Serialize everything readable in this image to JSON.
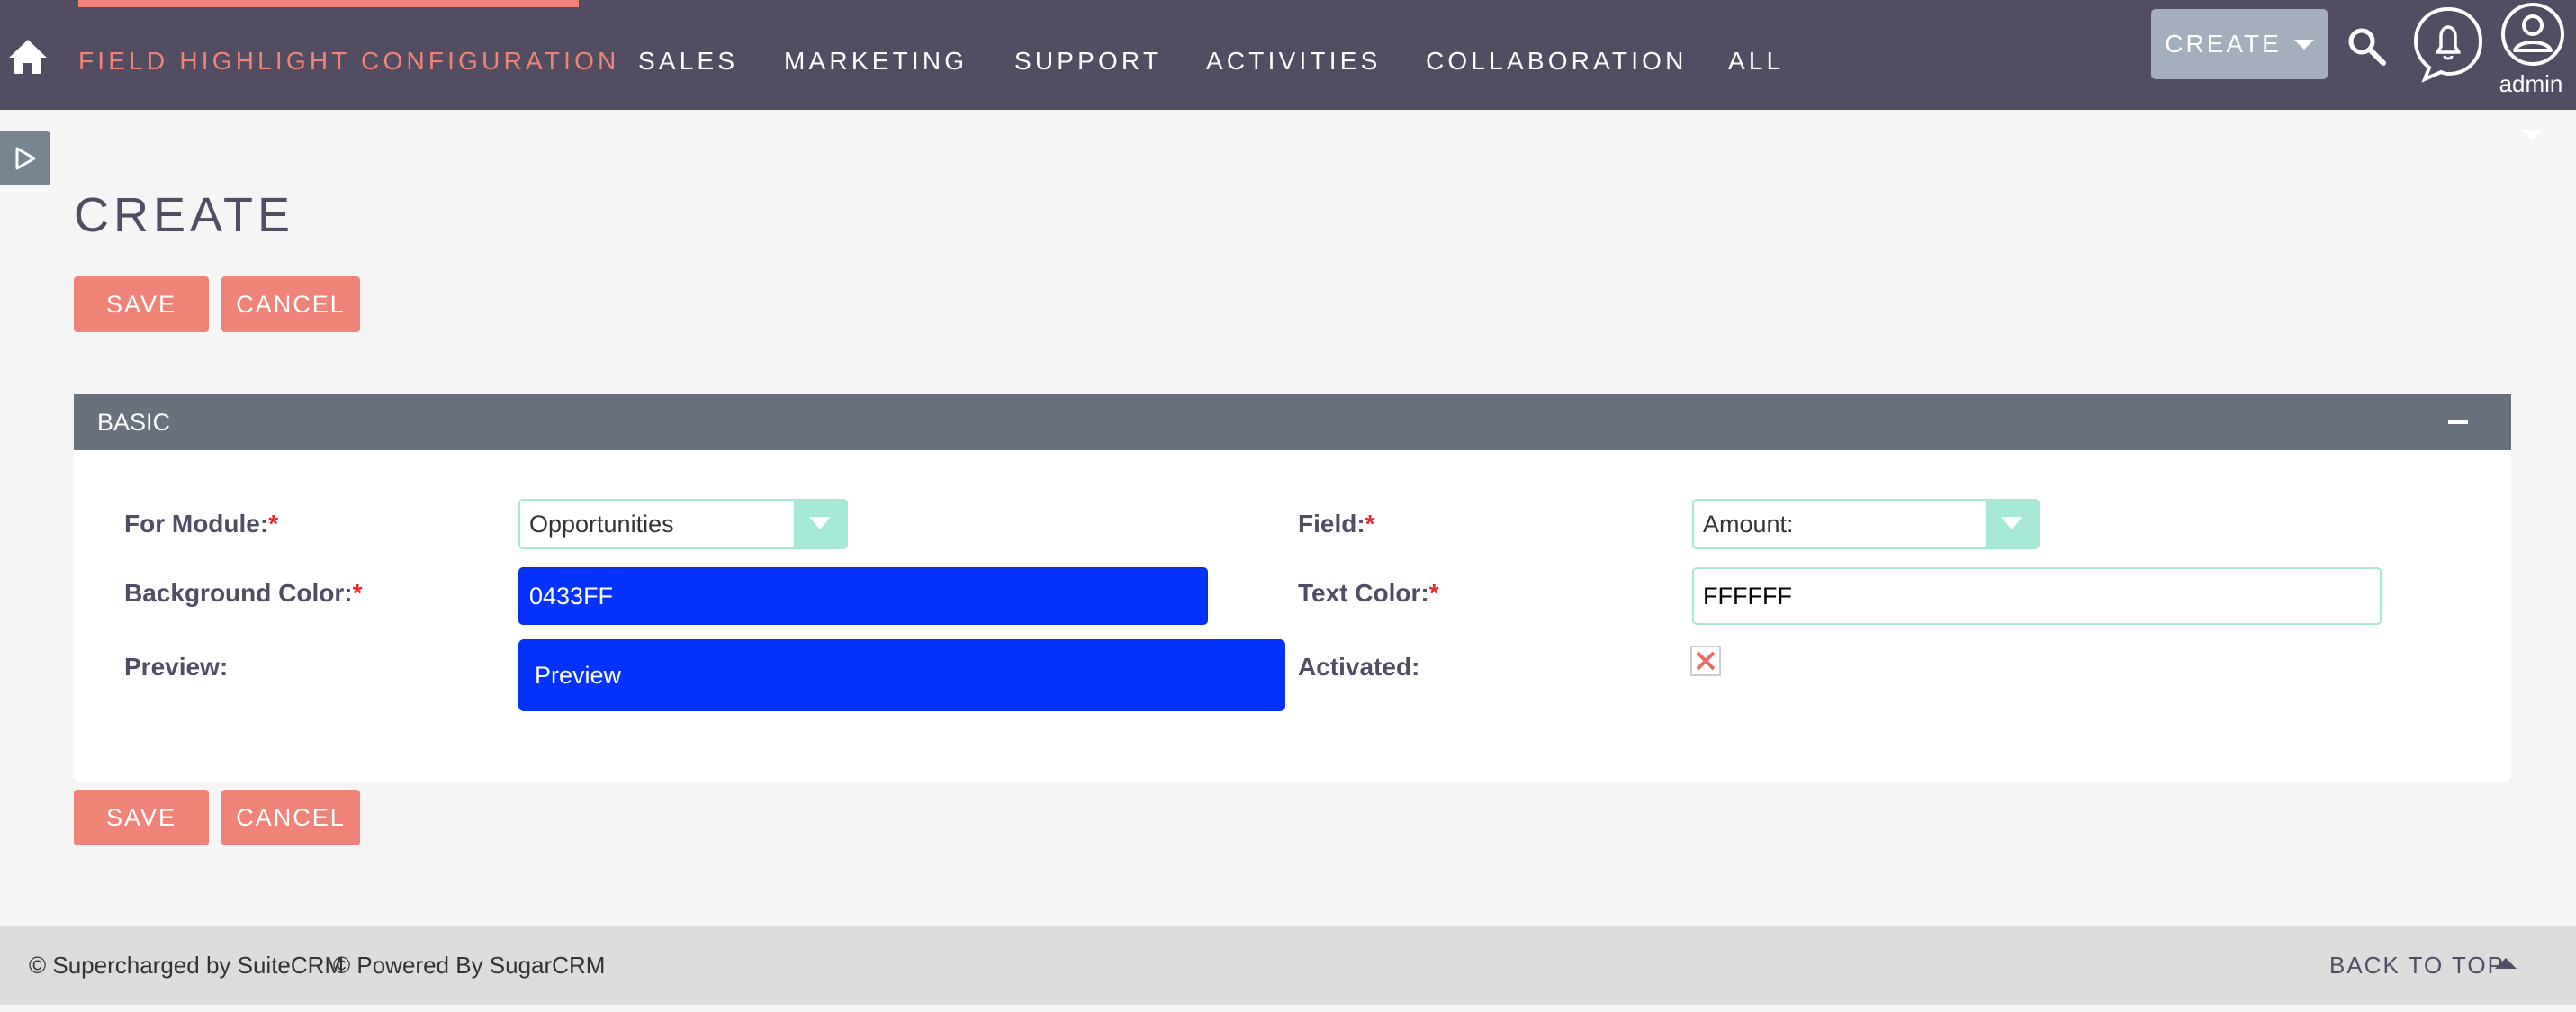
{
  "nav": {
    "active": "FIELD HIGHLIGHT CONFIGURATION",
    "items": [
      "SALES",
      "MARKETING",
      "SUPPORT",
      "ACTIVITIES",
      "COLLABORATION",
      "ALL"
    ],
    "create_label": "CREATE",
    "user": "admin",
    "icons": [
      "home-icon",
      "search-icon",
      "bell-icon",
      "user-icon"
    ]
  },
  "page": {
    "title": "CREATE"
  },
  "actions": {
    "save": "SAVE",
    "cancel": "CANCEL"
  },
  "panel": {
    "title": "BASIC",
    "fields": {
      "module": {
        "label": "For Module:",
        "required": "*",
        "value": "Opportunities"
      },
      "field": {
        "label": "Field:",
        "required": "*",
        "value": "Amount:"
      },
      "bg_color": {
        "label": "Background Color:",
        "required": "*",
        "value": "0433FF",
        "color": "#0433ff"
      },
      "text_color": {
        "label": "Text Color:",
        "required": "*",
        "value": "FFFFFF",
        "color": "#ffffff"
      },
      "preview": {
        "label": "Preview:",
        "value": "Preview"
      },
      "activated": {
        "label": "Activated:",
        "checked": false
      }
    }
  },
  "footer": {
    "suitecrm": "© Supercharged by SuiteCRM",
    "sugarcrm": "© Powered By SugarCRM",
    "back_to_top": "BACK TO TOP"
  },
  "colors": {
    "nav_bg": "#534d64",
    "accent": "#f08377",
    "panel_header": "#68717c",
    "select_accent": "#a5e8d6"
  }
}
